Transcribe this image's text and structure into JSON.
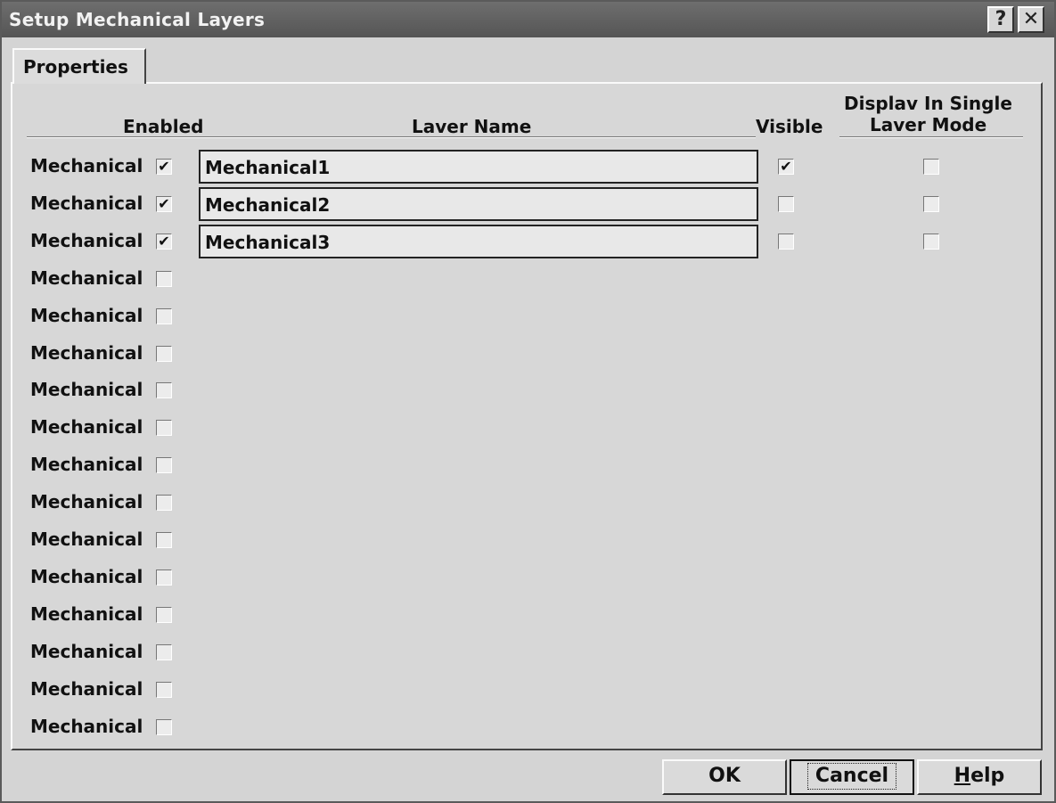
{
  "window": {
    "title": "Setup Mechanical Layers",
    "help_glyph": "?",
    "close_glyph": "✕"
  },
  "tabs": [
    {
      "label": "Properties"
    }
  ],
  "headers": {
    "enabled": "Enabled",
    "layer_name": "Laver Name",
    "visible": "Visible",
    "display_line1": "Displav In Single",
    "display_line2": "Laver Mode"
  },
  "check_glyph": "✔",
  "rows": [
    {
      "label": "Mechanical",
      "enabled": true,
      "name": "Mechanical1",
      "visible": true,
      "single": false
    },
    {
      "label": "Mechanical",
      "enabled": true,
      "name": "Mechanical2",
      "visible": false,
      "single": false
    },
    {
      "label": "Mechanical",
      "enabled": true,
      "name": "Mechanical3",
      "visible": false,
      "single": false
    },
    {
      "label": "Mechanical",
      "enabled": false
    },
    {
      "label": "Mechanical",
      "enabled": false
    },
    {
      "label": "Mechanical",
      "enabled": false
    },
    {
      "label": "Mechanical",
      "enabled": false
    },
    {
      "label": "Mechanical",
      "enabled": false
    },
    {
      "label": "Mechanical",
      "enabled": false
    },
    {
      "label": "Mechanical",
      "enabled": false
    },
    {
      "label": "Mechanical",
      "enabled": false
    },
    {
      "label": "Mechanical",
      "enabled": false
    },
    {
      "label": "Mechanical",
      "enabled": false
    },
    {
      "label": "Mechanical",
      "enabled": false
    },
    {
      "label": "Mechanical",
      "enabled": false
    },
    {
      "label": "Mechanical",
      "enabled": false
    }
  ],
  "buttons": {
    "ok": "OK",
    "cancel": "Cancel",
    "help_first": "H",
    "help_rest": "elp"
  }
}
